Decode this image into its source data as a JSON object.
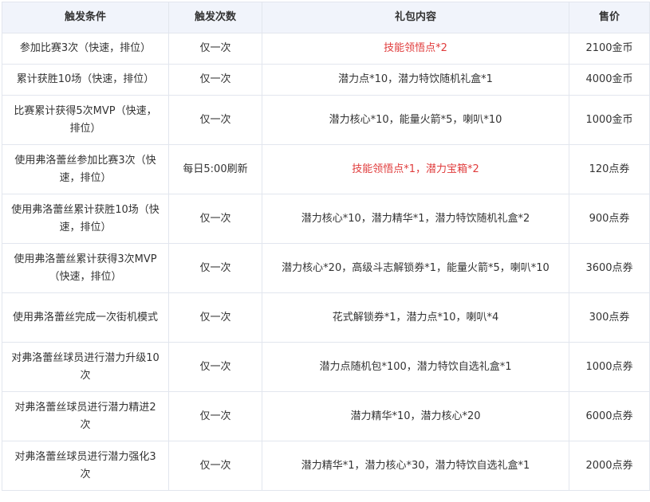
{
  "table": {
    "headers": [
      "触发条件",
      "触发次数",
      "礼包内容",
      "售价"
    ],
    "rows": [
      {
        "condition": "参加比赛3次（快速，排位）",
        "count": "仅一次",
        "content": "技能领悟点*2",
        "price": "2100金币",
        "highlight": true
      },
      {
        "condition": "累计获胜10场（快速，排位）",
        "count": "仅一次",
        "content": "潜力点*10，潜力特饮随机礼盒*1",
        "price": "4000金币",
        "highlight": false
      },
      {
        "condition": "比赛累计获得5次MVP（快速，排位）",
        "count": "仅一次",
        "content": "潜力核心*10，能量火箭*5，喇叭*10",
        "price": "1000金币",
        "highlight": false
      },
      {
        "condition": "使用弗洛蕾丝参加比赛3次（快速，排位）",
        "count": "每日5:00刷新",
        "content": "技能领悟点*1，潜力宝箱*2",
        "price": "120点券",
        "highlight": true
      },
      {
        "condition": "使用弗洛蕾丝累计获胜10场（快速，排位）",
        "count": "仅一次",
        "content": "潜力核心*10，潜力精华*1，潜力特饮随机礼盒*2",
        "price": "900点券",
        "highlight": false
      },
      {
        "condition": "使用弗洛蕾丝累计获得3次MVP（快速，排位）",
        "count": "仅一次",
        "content": "潜力核心*20，高级斗志解锁券*1，能量火箭*5，喇叭*10",
        "price": "3600点券",
        "highlight": false
      },
      {
        "condition": "使用弗洛蕾丝完成一次街机模式",
        "count": "仅一次",
        "content": "花式解锁券*1，潜力点*10，喇叭*4",
        "price": "300点券",
        "highlight": false
      },
      {
        "condition": "对弗洛蕾丝球员进行潜力升级10次",
        "count": "仅一次",
        "content": "潜力点随机包*100，潜力特饮自选礼盒*1",
        "price": "1000点券",
        "highlight": false
      },
      {
        "condition": "对弗洛蕾丝球员进行潜力精进2次",
        "count": "仅一次",
        "content": "潜力精华*10，潜力核心*20",
        "price": "6000点券",
        "highlight": false
      },
      {
        "condition": "对弗洛蕾丝球员进行潜力强化3次",
        "count": "仅一次",
        "content": "潜力精华*1，潜力核心*30，潜力特饮自选礼盒*1",
        "price": "2000点券",
        "highlight": false
      }
    ]
  },
  "colors": {
    "header_bg": "#f1f4fb",
    "border": "#e2e6ee",
    "highlight_text": "#e03c3c",
    "body_text": "#333333"
  }
}
